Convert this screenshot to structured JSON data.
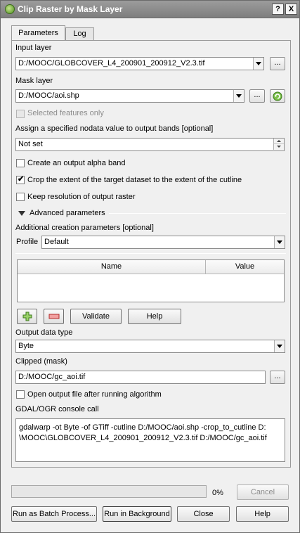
{
  "window": {
    "title": "Clip Raster by Mask Layer",
    "help_btn": "?",
    "close_btn": "X"
  },
  "tabs": [
    "Parameters",
    "Log"
  ],
  "input_layer": {
    "label": "Input layer",
    "value": "D:/MOOC/GLOBCOVER_L4_200901_200912_V2.3.tif",
    "browse": "..."
  },
  "mask_layer": {
    "label": "Mask layer",
    "value": "D:/MOOC/aoi.shp",
    "browse": "..."
  },
  "selected_only": {
    "label": "Selected features only"
  },
  "nodata": {
    "label": "Assign a specified nodata value to output bands [optional]",
    "value": "Not set"
  },
  "options": {
    "alpha": "Create an output alpha band",
    "crop": "Crop the extent of the target dataset to the extent of the cutline",
    "keep_res": "Keep resolution of output raster"
  },
  "advanced": {
    "header": "Advanced parameters",
    "creation_label": "Additional creation parameters [optional]",
    "profile_label": "Profile",
    "profile_value": "Default",
    "columns": [
      "Name",
      "Value"
    ],
    "validate": "Validate",
    "help": "Help"
  },
  "output_type": {
    "label": "Output data type",
    "value": "Byte"
  },
  "clipped": {
    "label": "Clipped (mask)",
    "value": "D:/MOOC/gc_aoi.tif",
    "browse": "..."
  },
  "open_output": {
    "label": "Open output file after running algorithm"
  },
  "console": {
    "label": "GDAL/OGR console call",
    "text": "gdalwarp -ot Byte -of GTiff -cutline D:/MOOC/aoi.shp -crop_to_cutline D:\n\\MOOC\\GLOBCOVER_L4_200901_200912_V2.3.tif D:/MOOC/gc_aoi.tif"
  },
  "progress": {
    "percent_label": "0%",
    "value": 0,
    "cancel": "Cancel"
  },
  "footer": {
    "batch": "Run as Batch Process...",
    "background": "Run in Background",
    "close": "Close",
    "help": "Help"
  }
}
